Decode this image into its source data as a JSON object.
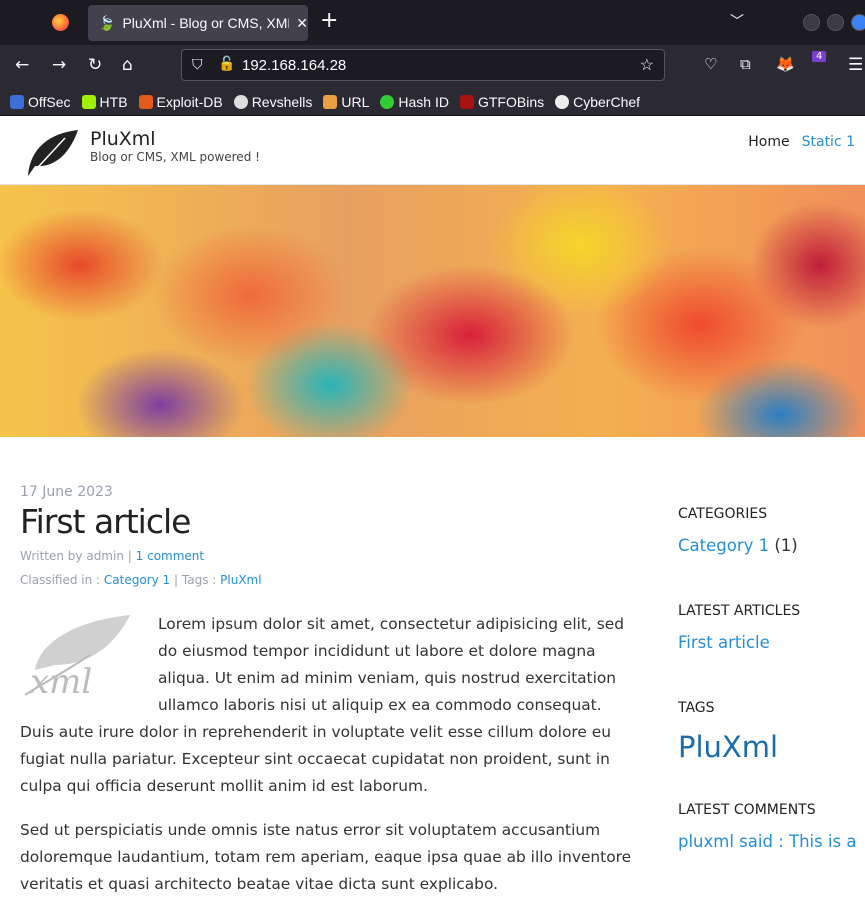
{
  "browser": {
    "tab_title": "PluXml - Blog or CMS, XML powered !",
    "url": "192.168.164.28",
    "extension_badge": "4",
    "bookmarks": [
      {
        "label": "OffSec",
        "color": "#3b6fd6"
      },
      {
        "label": "HTB",
        "color": "#9fef00"
      },
      {
        "label": "Exploit-DB",
        "color": "#e25a1c"
      },
      {
        "label": "Revshells",
        "color": "#dddddd"
      },
      {
        "label": "URL",
        "color": "#e8a040"
      },
      {
        "label": "Hash ID",
        "color": "#33cc33"
      },
      {
        "label": "GTFOBins",
        "color": "#aa1111"
      },
      {
        "label": "CyberChef",
        "color": "#eeeeee"
      }
    ]
  },
  "site": {
    "name": "PluXml",
    "description": "Blog or CMS, XML powered !",
    "menu": [
      {
        "label": "Home"
      },
      {
        "label": "Static 1"
      }
    ]
  },
  "article": {
    "date": "17 June 2023",
    "title": "First article",
    "written_by": "Written by admin",
    "separator": "|",
    "comments": "1 comment",
    "classified_label": "Classified in :",
    "category": "Category 1",
    "tags_label": "Tags :",
    "tag": "PluXml",
    "paragraphs": [
      "Lorem ipsum dolor sit amet, consectetur adipisicing elit, sed do eiusmod tempor incididunt ut labore et dolore magna aliqua. Ut enim ad minim veniam, quis nostrud exercitation ullamco laboris nisi ut aliquip ex ea commodo consequat. Duis aute irure dolor in reprehenderit in voluptate velit esse cillum dolore eu fugiat nulla pariatur. Excepteur sint occaecat cupidatat non proident, sunt in culpa qui officia deserunt mollit anim id est laborum.",
      "Sed ut perspiciatis unde omnis iste natus error sit voluptatem accusantium doloremque laudantium, totam rem aperiam, eaque ipsa quae ab illo inventore veritatis et quasi architecto beatae vitae dicta sunt explicabo."
    ]
  },
  "sidebar": {
    "categories_title": "CATEGORIES",
    "category": "Category 1",
    "category_count": "(1)",
    "latest_articles_title": "LATEST ARTICLES",
    "latest_article": "First article",
    "tags_title": "TAGS",
    "tag": "PluXml",
    "latest_comments_title": "LATEST COMMENTS",
    "latest_comment": "pluxml said : This is a"
  }
}
